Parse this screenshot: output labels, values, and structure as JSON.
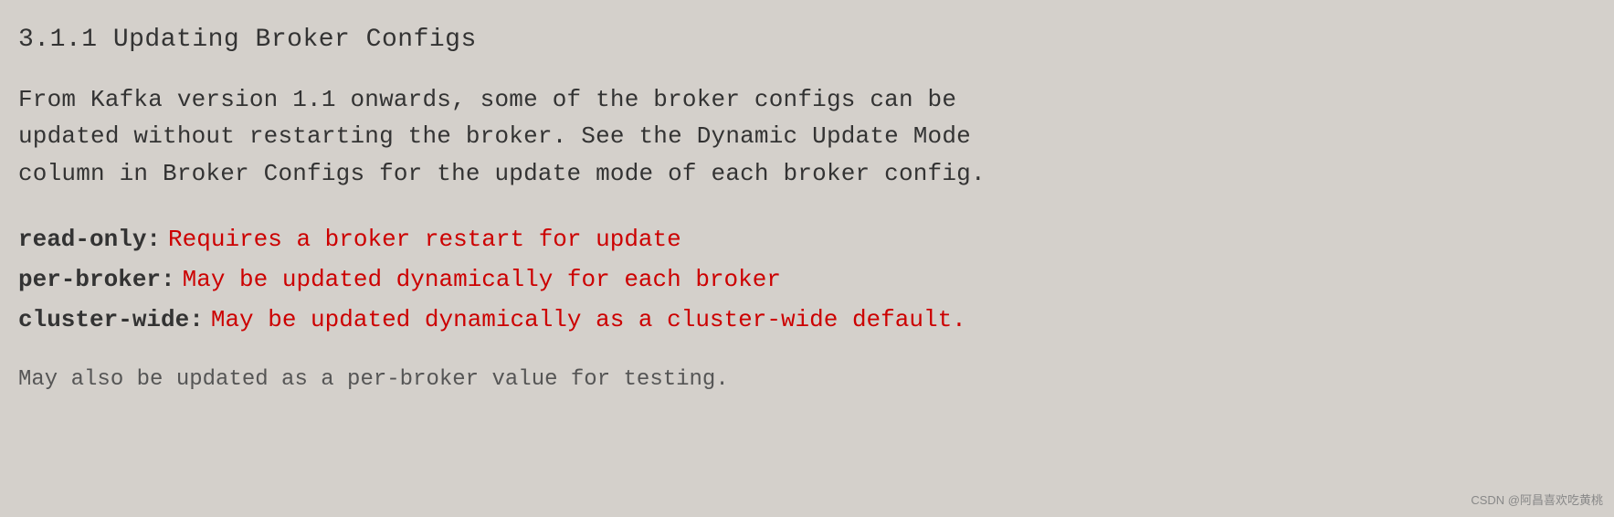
{
  "title": "3.1.1 Updating Broker Configs",
  "paragraph": {
    "line1": "From Kafka version 1.1 onwards, some of the broker configs can be",
    "line2": "updated without restarting the broker. See the Dynamic Update Mode",
    "line3": "column in Broker Configs for the update mode of each broker config."
  },
  "definitions": [
    {
      "term": "read-only:",
      "description": "Requires a broker restart for update"
    },
    {
      "term": "per-broker:",
      "description": "May be updated dynamically for each broker"
    },
    {
      "term": "cluster-wide:",
      "description": "May be updated dynamically as a cluster-wide default."
    }
  ],
  "footer": "May also be updated as a per-broker value for testing.",
  "watermark": "CSDN @阿昌喜欢吃黄桃"
}
